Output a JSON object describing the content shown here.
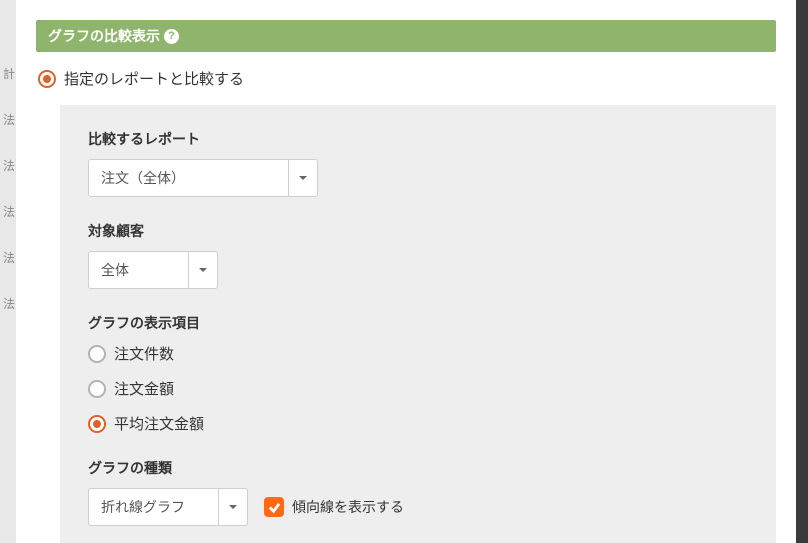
{
  "header": {
    "title": "グラフの比較表示"
  },
  "top_radio": {
    "label": "指定のレポートと比較する"
  },
  "report_select": {
    "label": "比較するレポート",
    "value": "注文（全体）"
  },
  "customer_select": {
    "label": "対象顧客",
    "value": "全体"
  },
  "display_items": {
    "label": "グラフの表示項目",
    "options": [
      {
        "label": "注文件数",
        "checked": false
      },
      {
        "label": "注文金額",
        "checked": false
      },
      {
        "label": "平均注文金額",
        "checked": true
      }
    ]
  },
  "graph_type": {
    "label": "グラフの種類",
    "value": "折れ線グラフ",
    "trendline_label": "傾向線を表示する"
  },
  "sidebar_hints": [
    "計",
    "",
    "法",
    "",
    "法",
    "",
    "法",
    "",
    "法",
    "",
    "法"
  ]
}
